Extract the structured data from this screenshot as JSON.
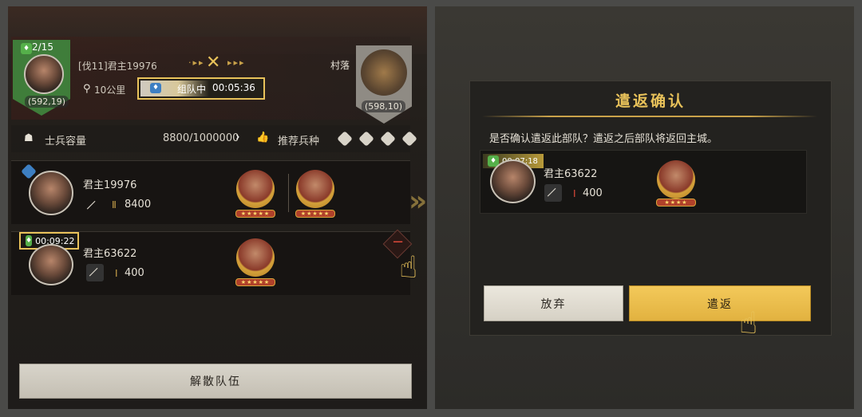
{
  "left": {
    "team_count": "2/15",
    "leader_coord": "(592,19)",
    "leader_name": "[伐11]君主19976",
    "distance": "10公里",
    "status_label": "组队中",
    "status_timer": "00:05:36",
    "target_name": "村落",
    "target_coord": "(598,10)",
    "capacity_label": "士兵容量",
    "capacity_value": "8800/1000000",
    "recommend_label": "推荐兵种",
    "members": [
      {
        "name": "君主19976",
        "troops": "8400",
        "stars": "★★★★★"
      },
      {
        "name": "君主63622",
        "troops": "400",
        "timer": "00:09:22",
        "stars": "★★★★★"
      }
    ],
    "disband_button": "解散队伍"
  },
  "dialog": {
    "title": "遣返确认",
    "message": "是否确认遣返此部队？遣返之后部队将返回主城。",
    "member_timer": "00:07:18",
    "member_name": "君主63622",
    "member_troops": "400",
    "stars": "★★★★",
    "cancel_button": "放弃",
    "confirm_button": "遣返"
  },
  "colors": {
    "accent": "#e8c25a",
    "green": "#3f7d3a",
    "confirm_bg": "#f0c050"
  }
}
